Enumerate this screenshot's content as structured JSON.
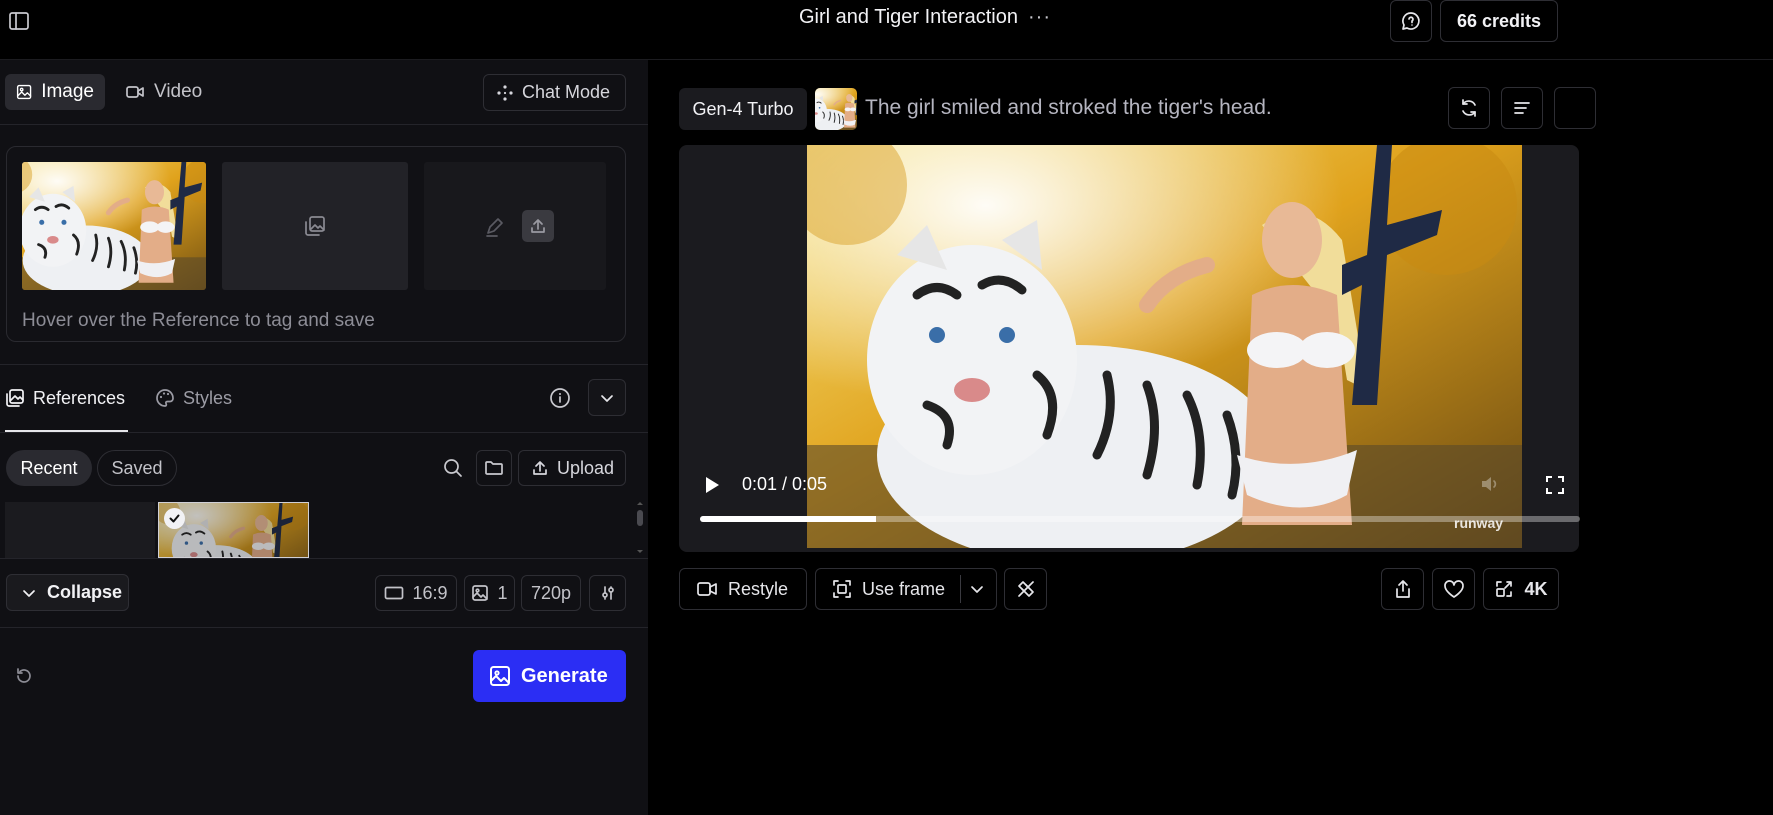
{
  "header": {
    "title": "Girl and Tiger Interaction",
    "more_glyph": "···",
    "credits_label": "66 credits"
  },
  "mode_tabs": {
    "image_label": "Image",
    "video_label": "Video",
    "chat_mode_label": "Chat Mode"
  },
  "reference_card": {
    "hint": "Hover over the Reference to tag and save"
  },
  "library": {
    "references_label": "References",
    "styles_label": "Styles",
    "filters": [
      "Recent",
      "Saved"
    ],
    "upload_label": "Upload"
  },
  "settings": {
    "collapse_label": "Collapse",
    "aspect_ratio": "16:9",
    "count": "1",
    "resolution": "720p"
  },
  "generate_label": "Generate",
  "output": {
    "model": "Gen-4 Turbo",
    "prompt": "The girl smiled and stroked the tiger's head.",
    "time": "0:01 / 0:05",
    "progress": 0.2,
    "watermark": "runway"
  },
  "actions": {
    "restyle_label": "Restyle",
    "use_frame_label": "Use frame",
    "upscale_label": "4K"
  },
  "colors": {
    "accent": "#2b2ef4",
    "panel": "#101014",
    "background": "#000000"
  }
}
